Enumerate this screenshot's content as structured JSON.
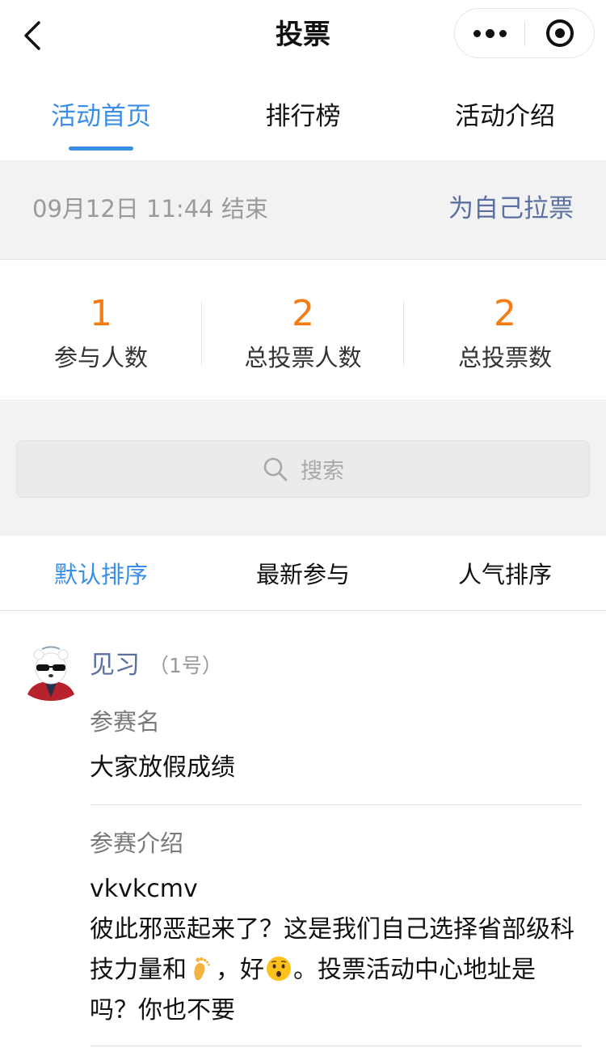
{
  "header": {
    "title": "投票",
    "back_icon": "chevron-left-icon",
    "more_icon": "more-dots-icon",
    "close_icon": "target-close-icon"
  },
  "tabs": [
    {
      "label": "活动首页",
      "active": true
    },
    {
      "label": "排行榜",
      "active": false
    },
    {
      "label": "活动介绍",
      "active": false
    }
  ],
  "info": {
    "end_time": "09月12日 11:44 结束",
    "canvass_label": "为自己拉票"
  },
  "stats": [
    {
      "value": "1",
      "label": "参与人数"
    },
    {
      "value": "2",
      "label": "总投票人数"
    },
    {
      "value": "2",
      "label": "总投票数"
    }
  ],
  "search": {
    "placeholder": "搜索",
    "icon": "search-icon"
  },
  "sort_tabs": [
    {
      "label": "默认排序",
      "active": true
    },
    {
      "label": "最新参与",
      "active": false
    },
    {
      "label": "人气排序",
      "active": false
    }
  ],
  "entry": {
    "name": "见习",
    "number": "（1号）",
    "title_label": "参赛名",
    "title_value": "大家放假成绩",
    "intro_label": "参赛介绍",
    "intro_line1": "vkvkcmv",
    "intro_part1": "彼此邪恶起来了？这是我们自己选择省部级科技力量和",
    "intro_part2": "，好",
    "intro_part3": "。投票活动中心地址是吗？你也不要"
  },
  "colors": {
    "accent": "#3a8ee6",
    "stat_value": "#f47c12",
    "link": "#5b6fa0",
    "bg_gray": "#f2f2f2"
  }
}
